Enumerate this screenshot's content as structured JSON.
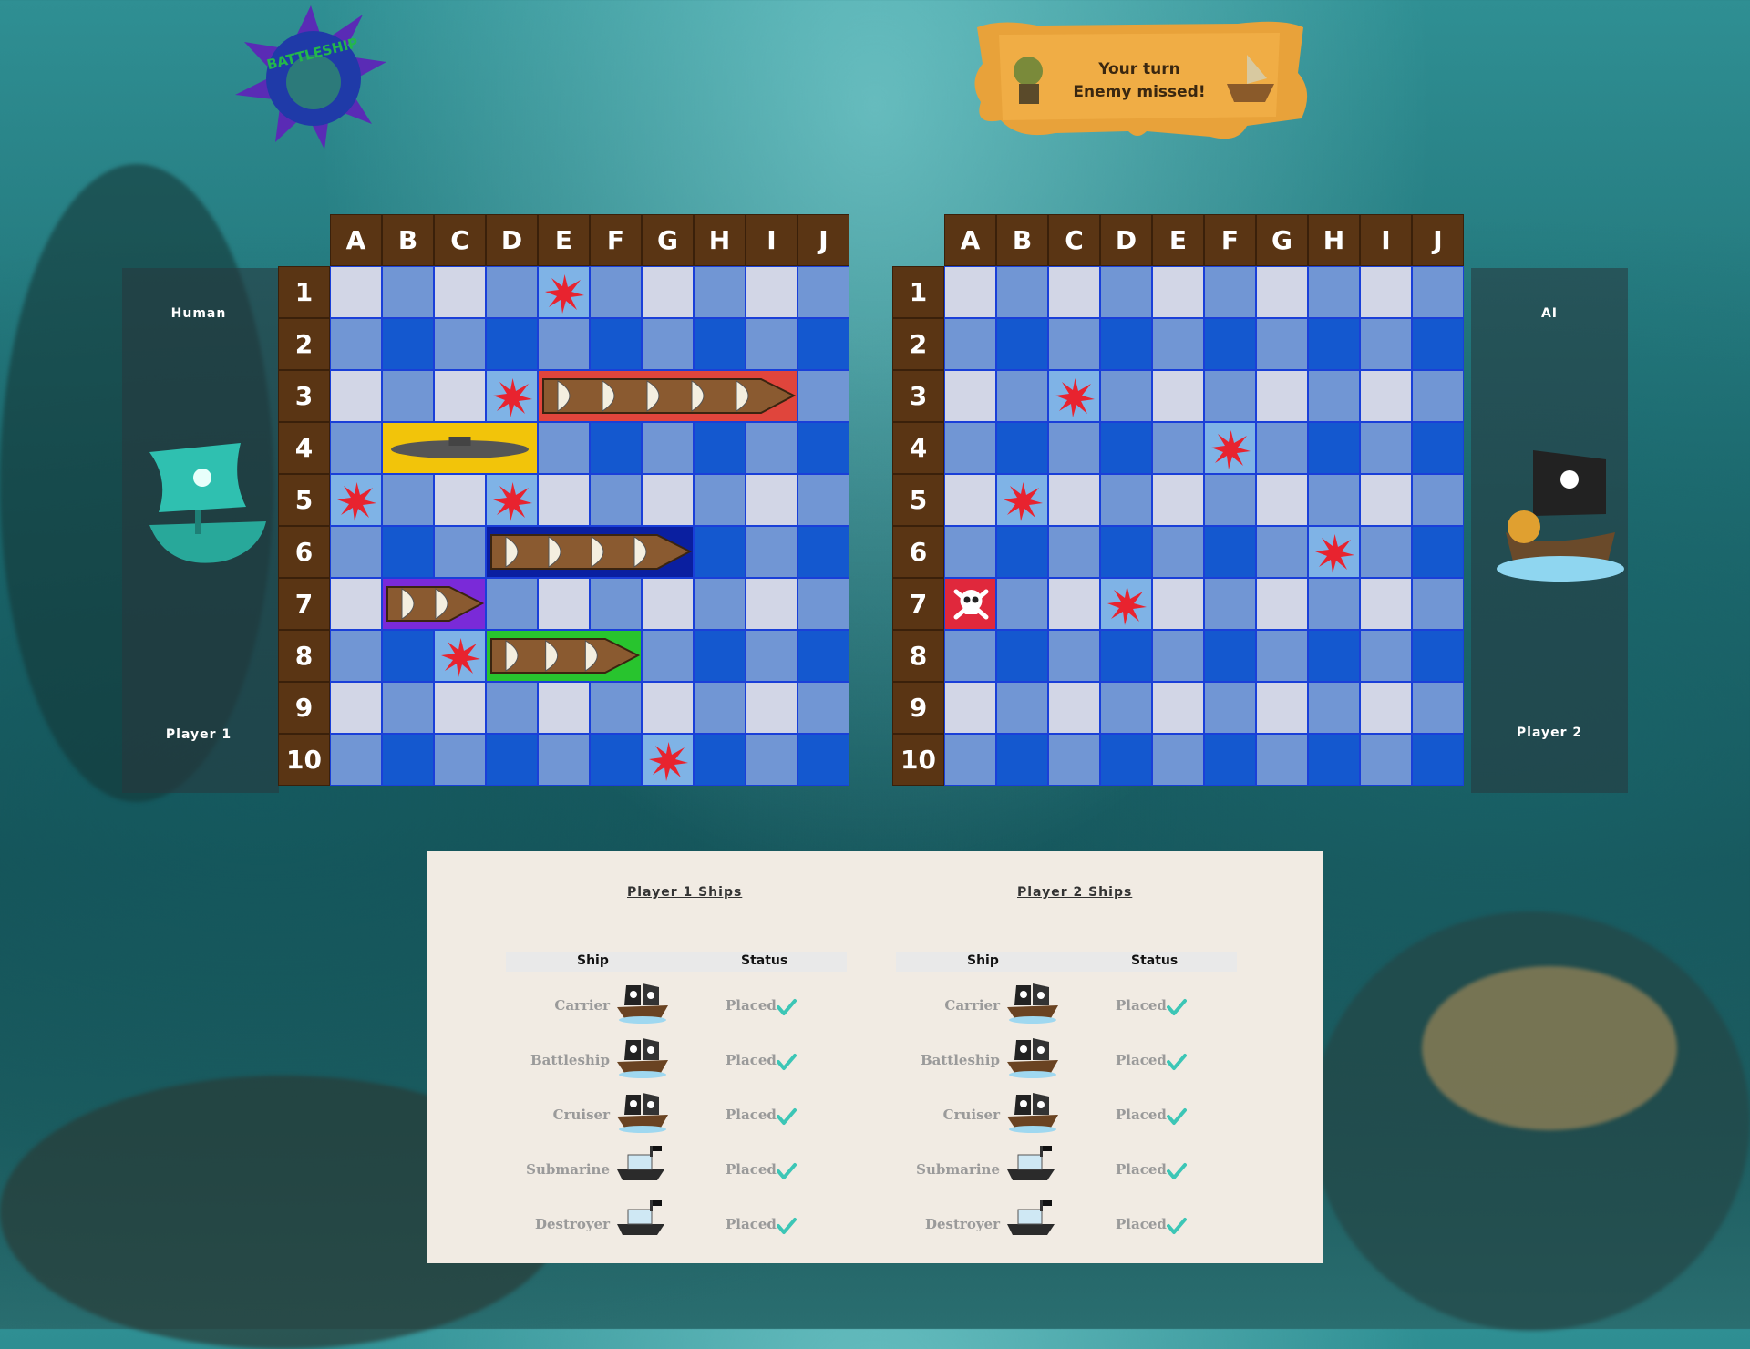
{
  "banner": {
    "line1": "Your turn",
    "line2": "Enemy missed!"
  },
  "logo": {
    "text": "BATTLESHIP"
  },
  "players": {
    "left": {
      "type": "Human",
      "name": "Player 1"
    },
    "right": {
      "type": "AI",
      "name": "Player 2"
    }
  },
  "columns": [
    "A",
    "B",
    "C",
    "D",
    "E",
    "F",
    "G",
    "H",
    "I",
    "J"
  ],
  "rows": [
    "1",
    "2",
    "3",
    "4",
    "5",
    "6",
    "7",
    "8",
    "9",
    "10"
  ],
  "boards": {
    "player1": {
      "misses": [
        "E1",
        "D3",
        "A5",
        "D5",
        "C8",
        "G10"
      ],
      "ships": [
        {
          "name": "Carrier",
          "cells": [
            "E3",
            "F3",
            "G3",
            "H3",
            "I3"
          ],
          "color": "#e0453c"
        },
        {
          "name": "Submarine",
          "cells": [
            "B4",
            "C4",
            "D4"
          ],
          "color": "#f2c40a"
        },
        {
          "name": "Battleship",
          "cells": [
            "D6",
            "E6",
            "F6",
            "G6"
          ],
          "color": "#0a1fa0"
        },
        {
          "name": "Destroyer",
          "cells": [
            "B7",
            "C7"
          ],
          "color": "#7a2ad8"
        },
        {
          "name": "Cruiser",
          "cells": [
            "D8",
            "E8",
            "F8"
          ],
          "color": "#28c42e"
        }
      ]
    },
    "player2": {
      "misses": [
        "C3",
        "F4",
        "B5",
        "H6",
        "D7"
      ],
      "hits": [
        "A7"
      ]
    }
  },
  "fleet_tables": [
    {
      "title": "Player 1 Ships",
      "col_ship": "Ship",
      "col_status": "Status",
      "rows": [
        {
          "ship": "Carrier",
          "status": "Placed"
        },
        {
          "ship": "Battleship",
          "status": "Placed"
        },
        {
          "ship": "Cruiser",
          "status": "Placed"
        },
        {
          "ship": "Submarine",
          "status": "Placed"
        },
        {
          "ship": "Destroyer",
          "status": "Placed"
        }
      ]
    },
    {
      "title": "Player 2 Ships",
      "col_ship": "Ship",
      "col_status": "Status",
      "rows": [
        {
          "ship": "Carrier",
          "status": "Placed"
        },
        {
          "ship": "Battleship",
          "status": "Placed"
        },
        {
          "ship": "Cruiser",
          "status": "Placed"
        },
        {
          "ship": "Submarine",
          "status": "Placed"
        },
        {
          "ship": "Destroyer",
          "status": "Placed"
        }
      ]
    }
  ],
  "colors": {
    "miss": "#e8232f",
    "check": "#3cc6b6",
    "header": "#5a3514"
  },
  "icons": {
    "miss": "miss-burst-icon",
    "hit": "skull-crossbones-icon",
    "placed": "checkmark-icon"
  }
}
